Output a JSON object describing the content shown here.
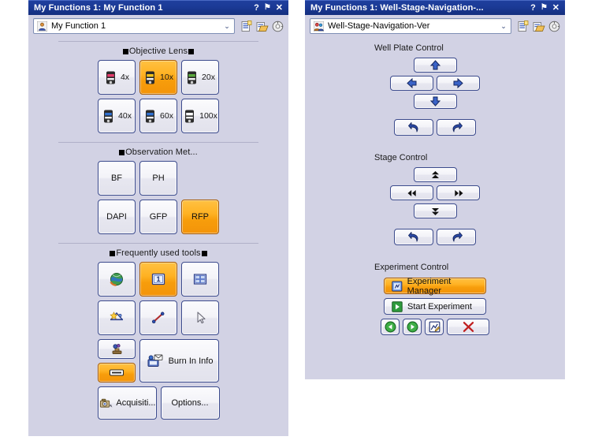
{
  "left_panel": {
    "titlebar": {
      "title": "My Functions 1: My Function 1",
      "help_label": "?",
      "pin_label": "⚑",
      "close_label": "✕"
    },
    "combo": {
      "value": "My Function 1",
      "caret": "⌄",
      "icon": "person-icon"
    },
    "toolbar_icons": [
      {
        "name": "new-list-icon"
      },
      {
        "name": "open-list-icon"
      },
      {
        "name": "settings-gear-icon"
      }
    ],
    "objective_lens": {
      "title": "Objective Lens",
      "items": [
        {
          "label": "4x",
          "band": "#e33a6a",
          "selected": false
        },
        {
          "label": "10x",
          "band": "#f2c21a",
          "selected": true
        },
        {
          "label": "20x",
          "band": "#5aa83c",
          "selected": false
        },
        {
          "label": "40x",
          "band": "#2f6fd0",
          "selected": false
        },
        {
          "label": "60x",
          "band": "#2f6fd0",
          "selected": false
        },
        {
          "label": "100x",
          "band": "#ffffff",
          "selected": false
        }
      ]
    },
    "observation_methods": {
      "title": "Observation Met...",
      "items": [
        {
          "label": "BF",
          "selected": false
        },
        {
          "label": "PH",
          "selected": false
        },
        {
          "label": "DAPI",
          "selected": false
        },
        {
          "label": "GFP",
          "selected": false
        },
        {
          "label": "RFP",
          "selected": true
        }
      ]
    },
    "frequently_used_tools": {
      "title": "Frequently used tools",
      "row1": [
        {
          "name": "live-capture-globe-icon",
          "selected": false
        },
        {
          "name": "single-image-icon",
          "selected": true,
          "label": "1"
        },
        {
          "name": "multi-panel-grid-icon",
          "selected": false
        }
      ],
      "row2": [
        {
          "name": "auto-adjust-star-icon",
          "selected": false
        },
        {
          "name": "measure-line-icon",
          "selected": false
        },
        {
          "name": "pointer-select-icon",
          "selected": false
        }
      ],
      "stack": [
        {
          "name": "stamp-annotate-icon",
          "selected": false
        },
        {
          "name": "scale-bar-icon",
          "selected": true
        }
      ],
      "burn_in": {
        "label": "Burn In Info",
        "icon": "burn-in-info-icon"
      },
      "bottom": [
        {
          "label": "Acquisiti...",
          "icon": "acquisition-icon"
        },
        {
          "label": "Options...",
          "icon": null
        }
      ]
    }
  },
  "right_panel": {
    "titlebar": {
      "title": "My Functions 1: Well-Stage-Navigation-...",
      "help_label": "?",
      "pin_label": "⚑",
      "close_label": "✕"
    },
    "combo": {
      "value": "Well-Stage-Navigation-Ver",
      "caret": "⌄",
      "icon": "people-icon"
    },
    "toolbar_icons": [
      {
        "name": "new-list-icon"
      },
      {
        "name": "open-list-icon"
      },
      {
        "name": "settings-gear-icon"
      }
    ],
    "well_plate_control": {
      "title": "Well Plate Control",
      "buttons": [
        {
          "name": "well-move-up-button",
          "icon": "arrow-up-icon"
        },
        {
          "name": "well-move-left-button",
          "icon": "arrow-left-icon"
        },
        {
          "name": "well-move-right-button",
          "icon": "arrow-right-icon"
        },
        {
          "name": "well-move-down-button",
          "icon": "arrow-down-icon"
        }
      ],
      "undo": {
        "name": "well-undo-button",
        "icon": "undo-icon"
      },
      "redo": {
        "name": "well-redo-button",
        "icon": "redo-icon"
      }
    },
    "stage_control": {
      "title": "Stage Control",
      "buttons": [
        {
          "name": "stage-move-up-button",
          "icon": "double-arrow-up-icon"
        },
        {
          "name": "stage-move-left-button",
          "icon": "double-arrow-left-icon"
        },
        {
          "name": "stage-move-right-button",
          "icon": "double-arrow-right-icon"
        },
        {
          "name": "stage-move-down-button",
          "icon": "double-arrow-down-icon"
        }
      ],
      "undo": {
        "name": "stage-undo-button",
        "icon": "undo-icon"
      },
      "redo": {
        "name": "stage-redo-button",
        "icon": "redo-icon"
      }
    },
    "experiment_control": {
      "title": "Experiment Control",
      "manager": {
        "label": "Experiment Manager",
        "icon": "experiment-manager-icon",
        "selected": true
      },
      "start": {
        "label": "Start Experiment",
        "icon": "play-icon",
        "selected": false
      },
      "nav": [
        {
          "name": "experiment-previous-button",
          "icon": "green-back-icon"
        },
        {
          "name": "experiment-next-button",
          "icon": "green-forward-icon"
        },
        {
          "name": "experiment-edit-button",
          "icon": "edit-chart-icon"
        },
        {
          "name": "experiment-cancel-button",
          "icon": "red-x-icon"
        }
      ]
    }
  },
  "colors": {
    "panel_bg": "#d2d2e4",
    "title_bar": "#1b3a95",
    "selected": "#f7a70c",
    "button_border": "#3b4a8c"
  }
}
